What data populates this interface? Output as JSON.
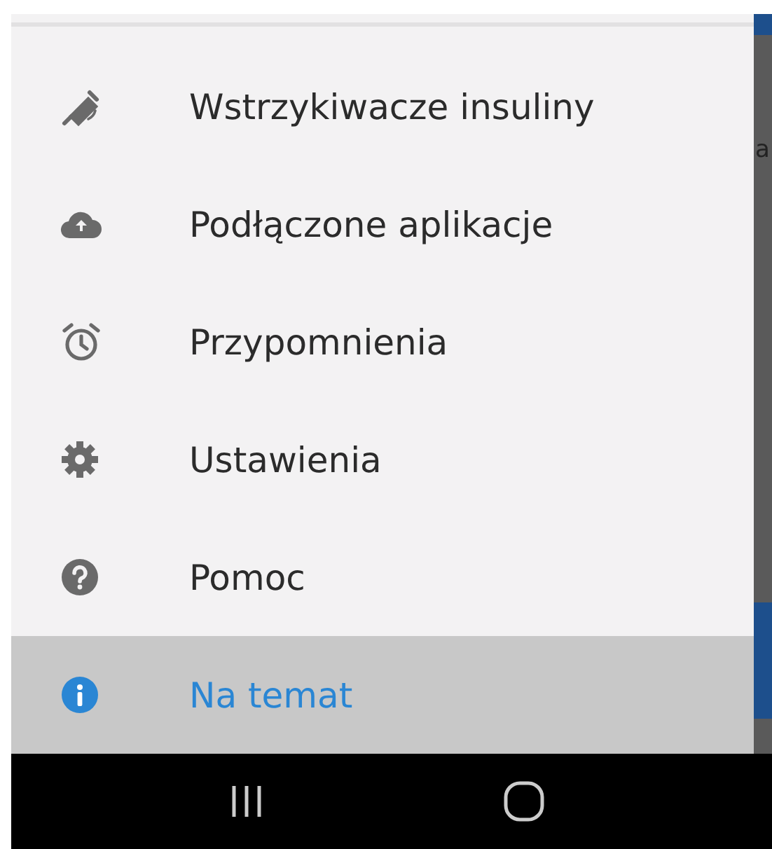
{
  "menu": {
    "items": [
      {
        "label": "Wstrzykiwacze insuliny",
        "kind": "pen",
        "selected": false
      },
      {
        "label": "Podłączone aplikacje",
        "kind": "cloud",
        "selected": false
      },
      {
        "label": "Przypomnienia",
        "kind": "alarm",
        "selected": false
      },
      {
        "label": "Ustawienia",
        "kind": "gear",
        "selected": false
      },
      {
        "label": "Pomoc",
        "kind": "help",
        "selected": false
      },
      {
        "label": "Na temat",
        "kind": "info",
        "selected": true
      }
    ]
  },
  "background": {
    "text": "a"
  }
}
